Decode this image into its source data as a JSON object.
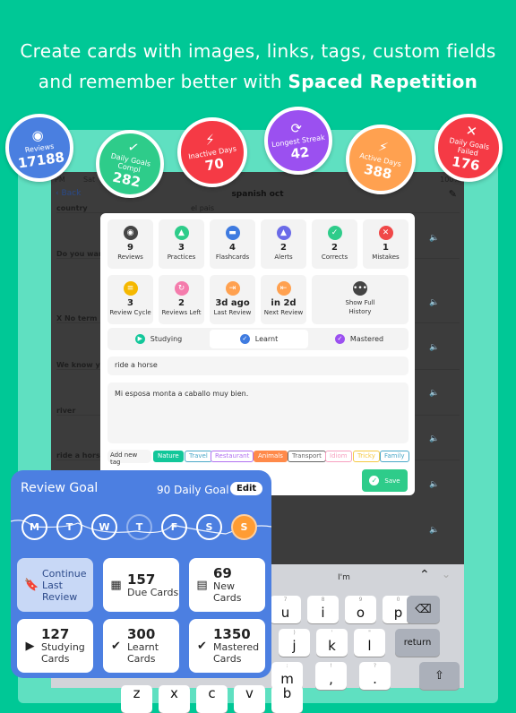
{
  "headline": {
    "line1": "Create cards with images, links, tags, custom fields",
    "line2_prefix": "and remember better with ",
    "line2_bold": "Spaced Repetition"
  },
  "stats_circles": [
    {
      "label": "Reviews",
      "value": "17188",
      "color": "#4a7fe0",
      "icon": "eye-icon"
    },
    {
      "label": "Daily Goals Compl",
      "value": "282",
      "color": "#2ecc8a",
      "icon": "check-icon"
    },
    {
      "label": "Inactive Days",
      "value": "70",
      "color": "#f53a45",
      "icon": "lightning-off-icon"
    },
    {
      "label": "Longest Streak",
      "value": "42",
      "color": "#9b50f0",
      "icon": "streak-icon"
    },
    {
      "label": "Active Days",
      "value": "388",
      "color": "#ffa150",
      "icon": "lightning-icon"
    },
    {
      "label": "Daily Goals Failed",
      "value": "176",
      "color": "#f53a45",
      "icon": "x-icon"
    }
  ],
  "device": {
    "time": "PM",
    "day": "Sat",
    "battery": "100%",
    "back": "Back",
    "title": "spanish oct",
    "rows": [
      {
        "term": "country",
        "def": "el pais"
      },
      {
        "term": "Do you wan"
      },
      {
        "term": "X No term"
      },
      {
        "term": "We know y"
      },
      {
        "term": "river"
      },
      {
        "term": "ride a horse"
      }
    ]
  },
  "modal": {
    "stats": [
      {
        "value": "9",
        "label": "Reviews",
        "color": "#444444",
        "icon": "eye-icon"
      },
      {
        "value": "3",
        "label": "Practices",
        "color": "#2ecc8a",
        "icon": "graduation-cap-icon"
      },
      {
        "value": "4",
        "label": "Flashcards",
        "color": "#3f7be0",
        "icon": "cards-icon"
      },
      {
        "value": "2",
        "label": "Alerts",
        "color": "#6b6be8",
        "icon": "bell-icon"
      },
      {
        "value": "2",
        "label": "Corrects",
        "color": "#2ecc8a",
        "icon": "check-icon"
      },
      {
        "value": "1",
        "label": "Mistakes",
        "color": "#f04848",
        "icon": "x-icon"
      },
      {
        "value": "3",
        "label": "Review Cycle",
        "color": "#f5b800",
        "icon": "layers-icon"
      },
      {
        "value": "2",
        "label": "Reviews Left",
        "color": "#f47cac",
        "icon": "refresh-icon"
      },
      {
        "value": "3d ago",
        "label": "Last Review",
        "color": "#ffa150",
        "icon": "exit-icon"
      },
      {
        "value": "in 2d",
        "label": "Next Review",
        "color": "#ffa150",
        "icon": "enter-icon"
      }
    ],
    "history": "Show Full History",
    "segments": [
      {
        "label": "Studying",
        "color": "#12c79a"
      },
      {
        "label": "Learnt",
        "color": "#3f7be0"
      },
      {
        "label": "Mastered",
        "color": "#9b50f0"
      }
    ],
    "selected_segment": "Learnt",
    "front": "ride a horse",
    "back": "Mi esposa monta a caballo muy bien.",
    "add_tag": "Add new tag",
    "tags": [
      {
        "label": "Nature",
        "color": "#12c79a",
        "filled": true
      },
      {
        "label": "Travel",
        "color": "#4aa8c8",
        "filled": false
      },
      {
        "label": "Restaurant",
        "color": "#b070f0",
        "filled": false
      },
      {
        "label": "Animals",
        "color": "#ff8a4a",
        "filled": true
      },
      {
        "label": "Transport",
        "color": "#666666",
        "filled": false
      },
      {
        "label": "Idiom",
        "color": "#f7a0c0",
        "filled": false
      },
      {
        "label": "Tricky",
        "color": "#f5c842",
        "filled": false
      },
      {
        "label": "Family",
        "color": "#4aa8c8",
        "filled": false
      }
    ],
    "save": "Save"
  },
  "goal": {
    "title": "Review Goal",
    "daily": "90 Daily Goal",
    "edit": "Edit",
    "days": [
      "M",
      "T",
      "W",
      "T",
      "F",
      "S",
      "S"
    ],
    "current_day_index": 6,
    "cards": [
      {
        "num": "",
        "text": "Continue Last Review",
        "icon": "bookmark-icon"
      },
      {
        "num": "157",
        "text": "Due Cards",
        "icon": "calendar-icon"
      },
      {
        "num": "69",
        "text": "New Cards",
        "icon": "newspaper-icon"
      },
      {
        "num": "127",
        "text": "Studying Cards",
        "icon": "play-icon"
      },
      {
        "num": "300",
        "text": "Learnt Cards",
        "icon": "check-circle-icon"
      },
      {
        "num": "1350",
        "text": "Mastered Cards",
        "icon": "double-check-icon"
      }
    ]
  },
  "keyboard": {
    "suggestion": "I'm",
    "row1": [
      {
        "k": "u",
        "s": "7"
      },
      {
        "k": "i",
        "s": "8"
      },
      {
        "k": "o",
        "s": "9"
      },
      {
        "k": "p",
        "s": "0"
      }
    ],
    "row2": [
      {
        "k": "j",
        "s": ")"
      },
      {
        "k": "k",
        "s": "'"
      },
      {
        "k": "l",
        "s": "\""
      }
    ],
    "return": "return",
    "row3": [
      {
        "k": "m",
        "s": ":"
      },
      {
        "k": ",",
        "s": "!"
      },
      {
        "k": ".",
        "s": "?"
      }
    ],
    "row4": [
      "z",
      "x",
      "c",
      "v",
      "b"
    ]
  }
}
